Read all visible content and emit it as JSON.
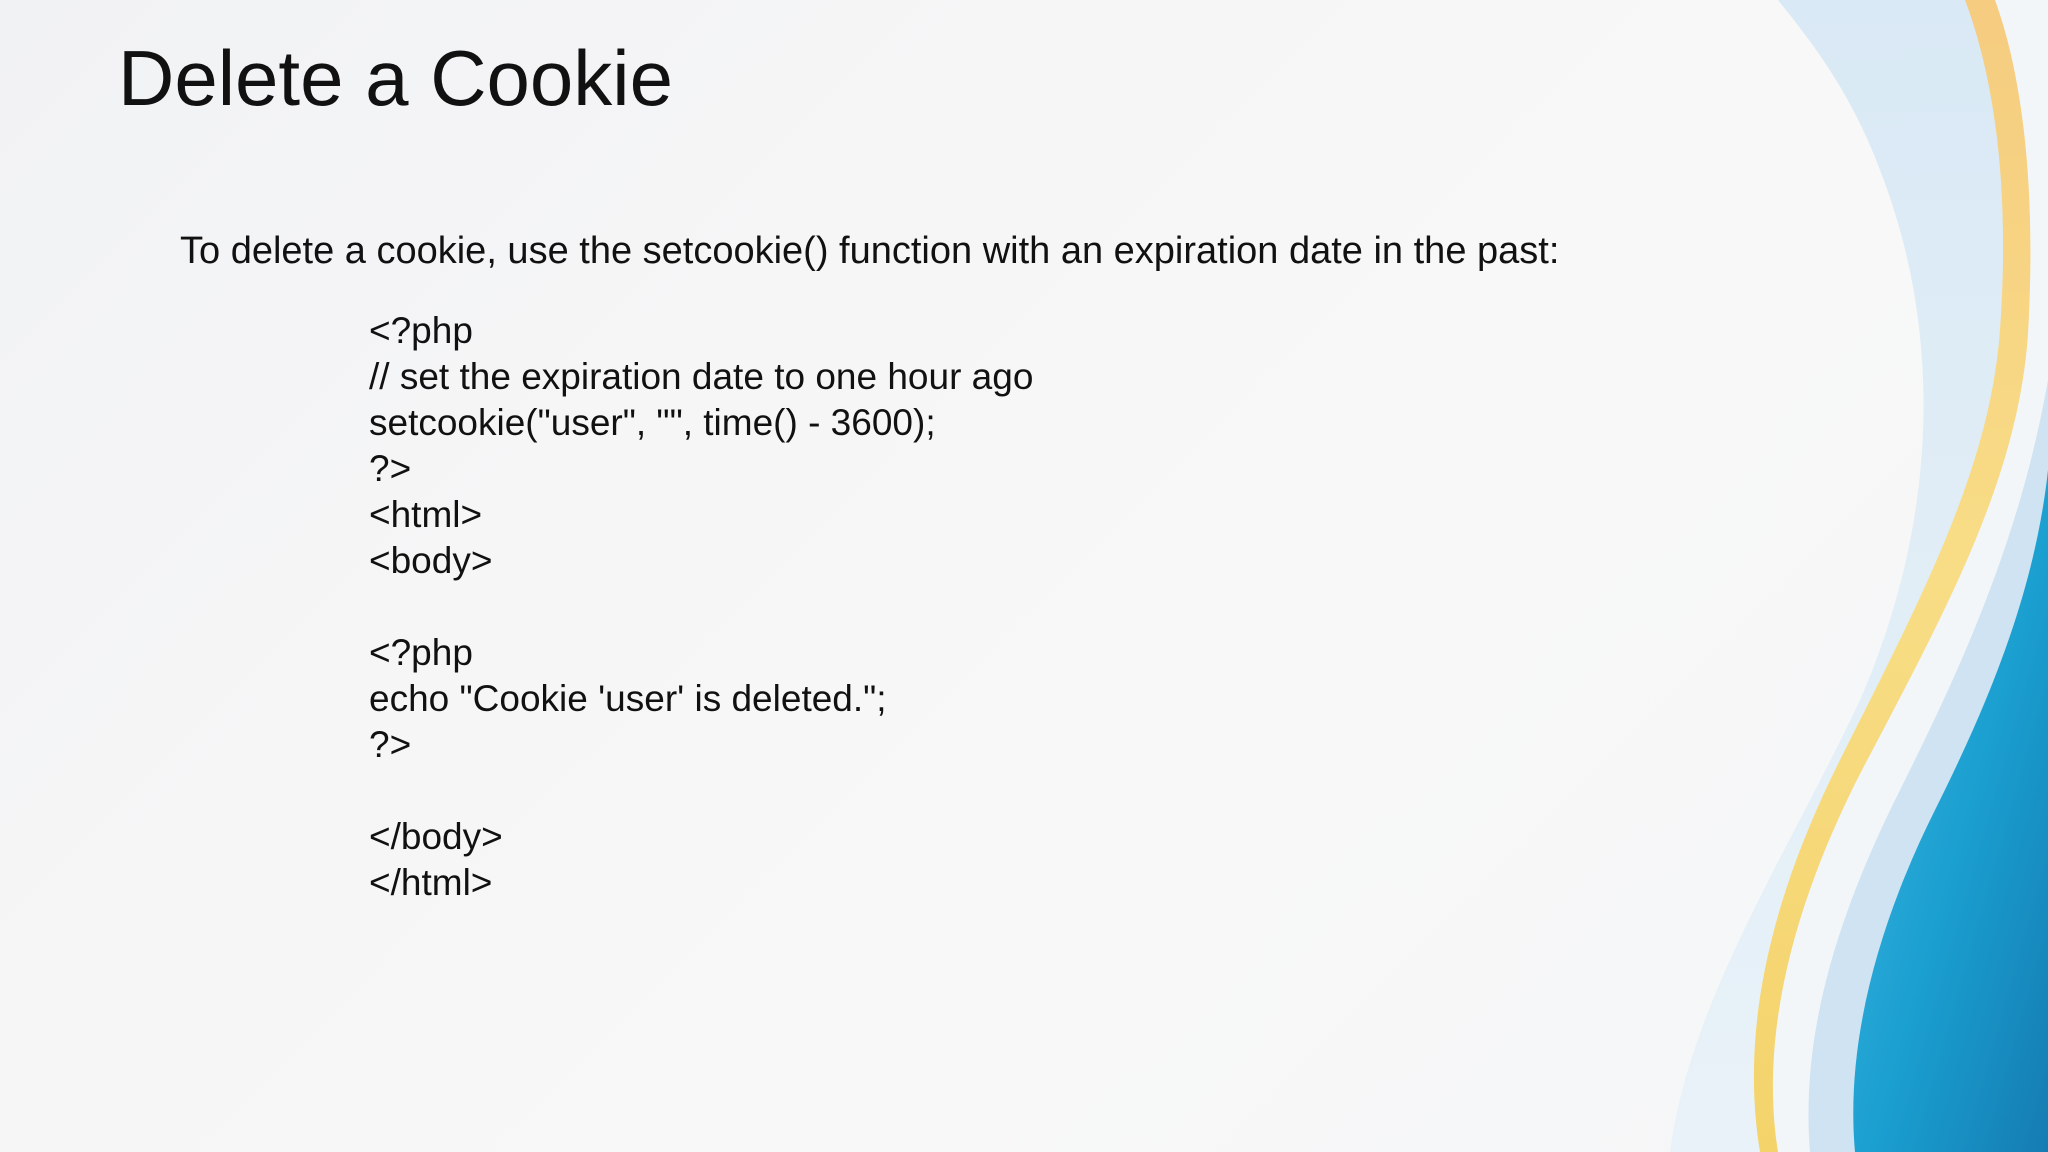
{
  "slide": {
    "title": "Delete a Cookie",
    "intro": "To delete a cookie, use the setcookie() function with an expiration date in the past:",
    "code_lines": [
      "<?php",
      "// set the expiration date to one hour ago",
      "setcookie(\"user\", \"\", time() - 3600);",
      "?>",
      "<html>",
      "<body>",
      "",
      "<?php",
      "echo \"Cookie 'user' is deleted.\";",
      "?>",
      "",
      "</body>",
      "</html>"
    ]
  },
  "colors": {
    "text": "#111111",
    "accent_blue": "#1a9fd0",
    "accent_yellow": "#f6d86a",
    "accent_orange": "#f3c07a",
    "light_blue": "#cfe3f2"
  }
}
